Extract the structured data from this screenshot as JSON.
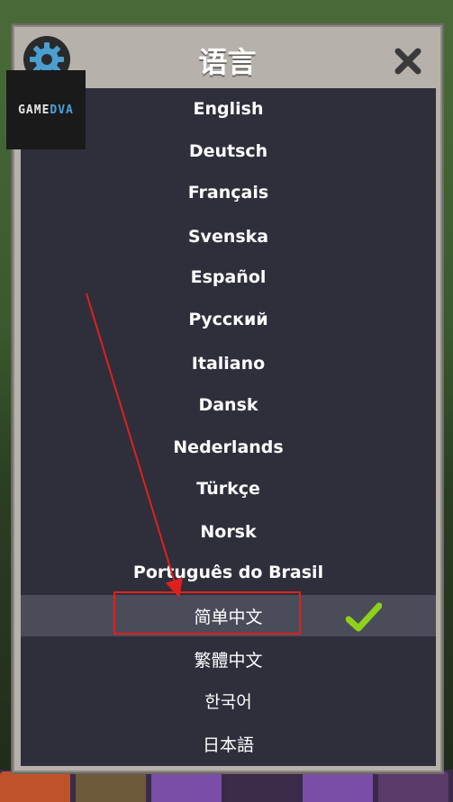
{
  "dialog": {
    "title": "语言",
    "watermark_a": "GAME",
    "watermark_b": "DVA"
  },
  "languages": [
    {
      "label": "English",
      "selected": false
    },
    {
      "label": "Deutsch",
      "selected": false
    },
    {
      "label": "Français",
      "selected": false
    },
    {
      "label": "Svenska",
      "selected": false
    },
    {
      "label": "Español",
      "selected": false
    },
    {
      "label": "Русский",
      "selected": false
    },
    {
      "label": "Italiano",
      "selected": false
    },
    {
      "label": "Dansk",
      "selected": false
    },
    {
      "label": "Nederlands",
      "selected": false
    },
    {
      "label": "Türkçe",
      "selected": false
    },
    {
      "label": "Norsk",
      "selected": false
    },
    {
      "label": "Português do Brasil",
      "selected": false
    },
    {
      "label": "简单中文",
      "selected": true
    },
    {
      "label": "繁體中文",
      "selected": false
    },
    {
      "label": "한국어",
      "selected": false
    },
    {
      "label": "日本語",
      "selected": false
    }
  ],
  "icons": {
    "settings": "gear-icon",
    "close": "close-icon",
    "selected": "checkmark-icon"
  },
  "colors": {
    "panel": "#b7b1ab",
    "list_bg": "#2e2f3b",
    "selected_row": "#4b4c5a",
    "check": "#8fd11a",
    "annotation": "#e0201e"
  }
}
